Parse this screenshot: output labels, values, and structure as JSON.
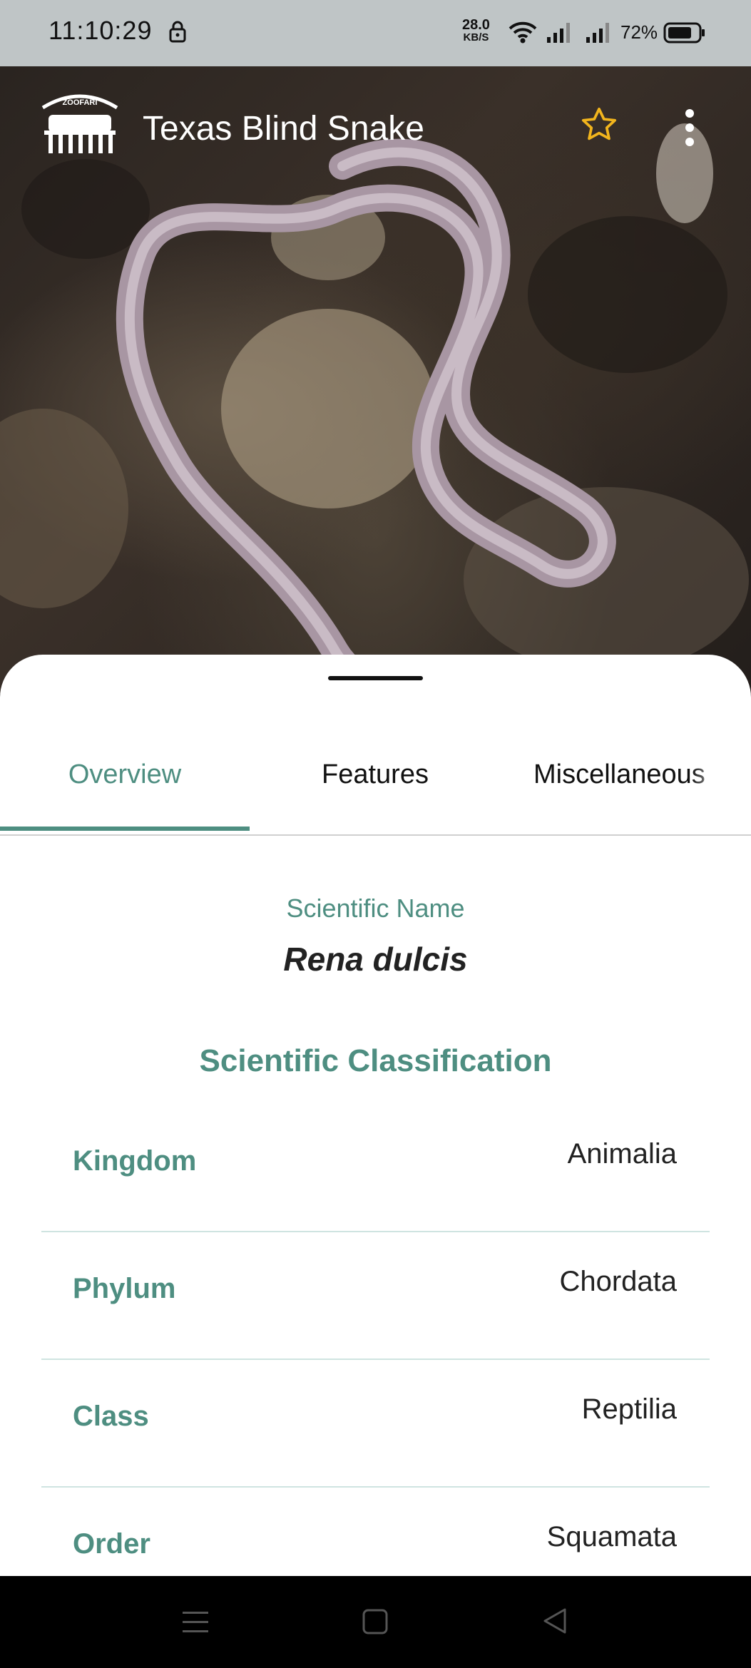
{
  "status_bar": {
    "time": "11:10:29",
    "net_speed_value": "28.0",
    "net_speed_unit": "KB/S",
    "battery": "72%"
  },
  "app_bar": {
    "title": "Texas Blind Snake",
    "logo_text": "ZOOFARI"
  },
  "tabs": [
    {
      "label": "Overview",
      "selected": true
    },
    {
      "label": "Features",
      "selected": false
    },
    {
      "label": "Miscellaneous",
      "selected": false
    }
  ],
  "overview": {
    "scientific_name_label": "Scientific Name",
    "scientific_name": "Rena dulcis",
    "classification_title": "Scientific Classification",
    "classification": [
      {
        "rank": "Kingdom",
        "value": "Animalia"
      },
      {
        "rank": "Phylum",
        "value": "Chordata"
      },
      {
        "rank": "Class",
        "value": "Reptilia"
      },
      {
        "rank": "Order",
        "value": "Squamata"
      }
    ]
  },
  "colors": {
    "accent": "#4e8e81",
    "star": "#f2b51d",
    "status_bar_bg": "#bfc5c6"
  }
}
